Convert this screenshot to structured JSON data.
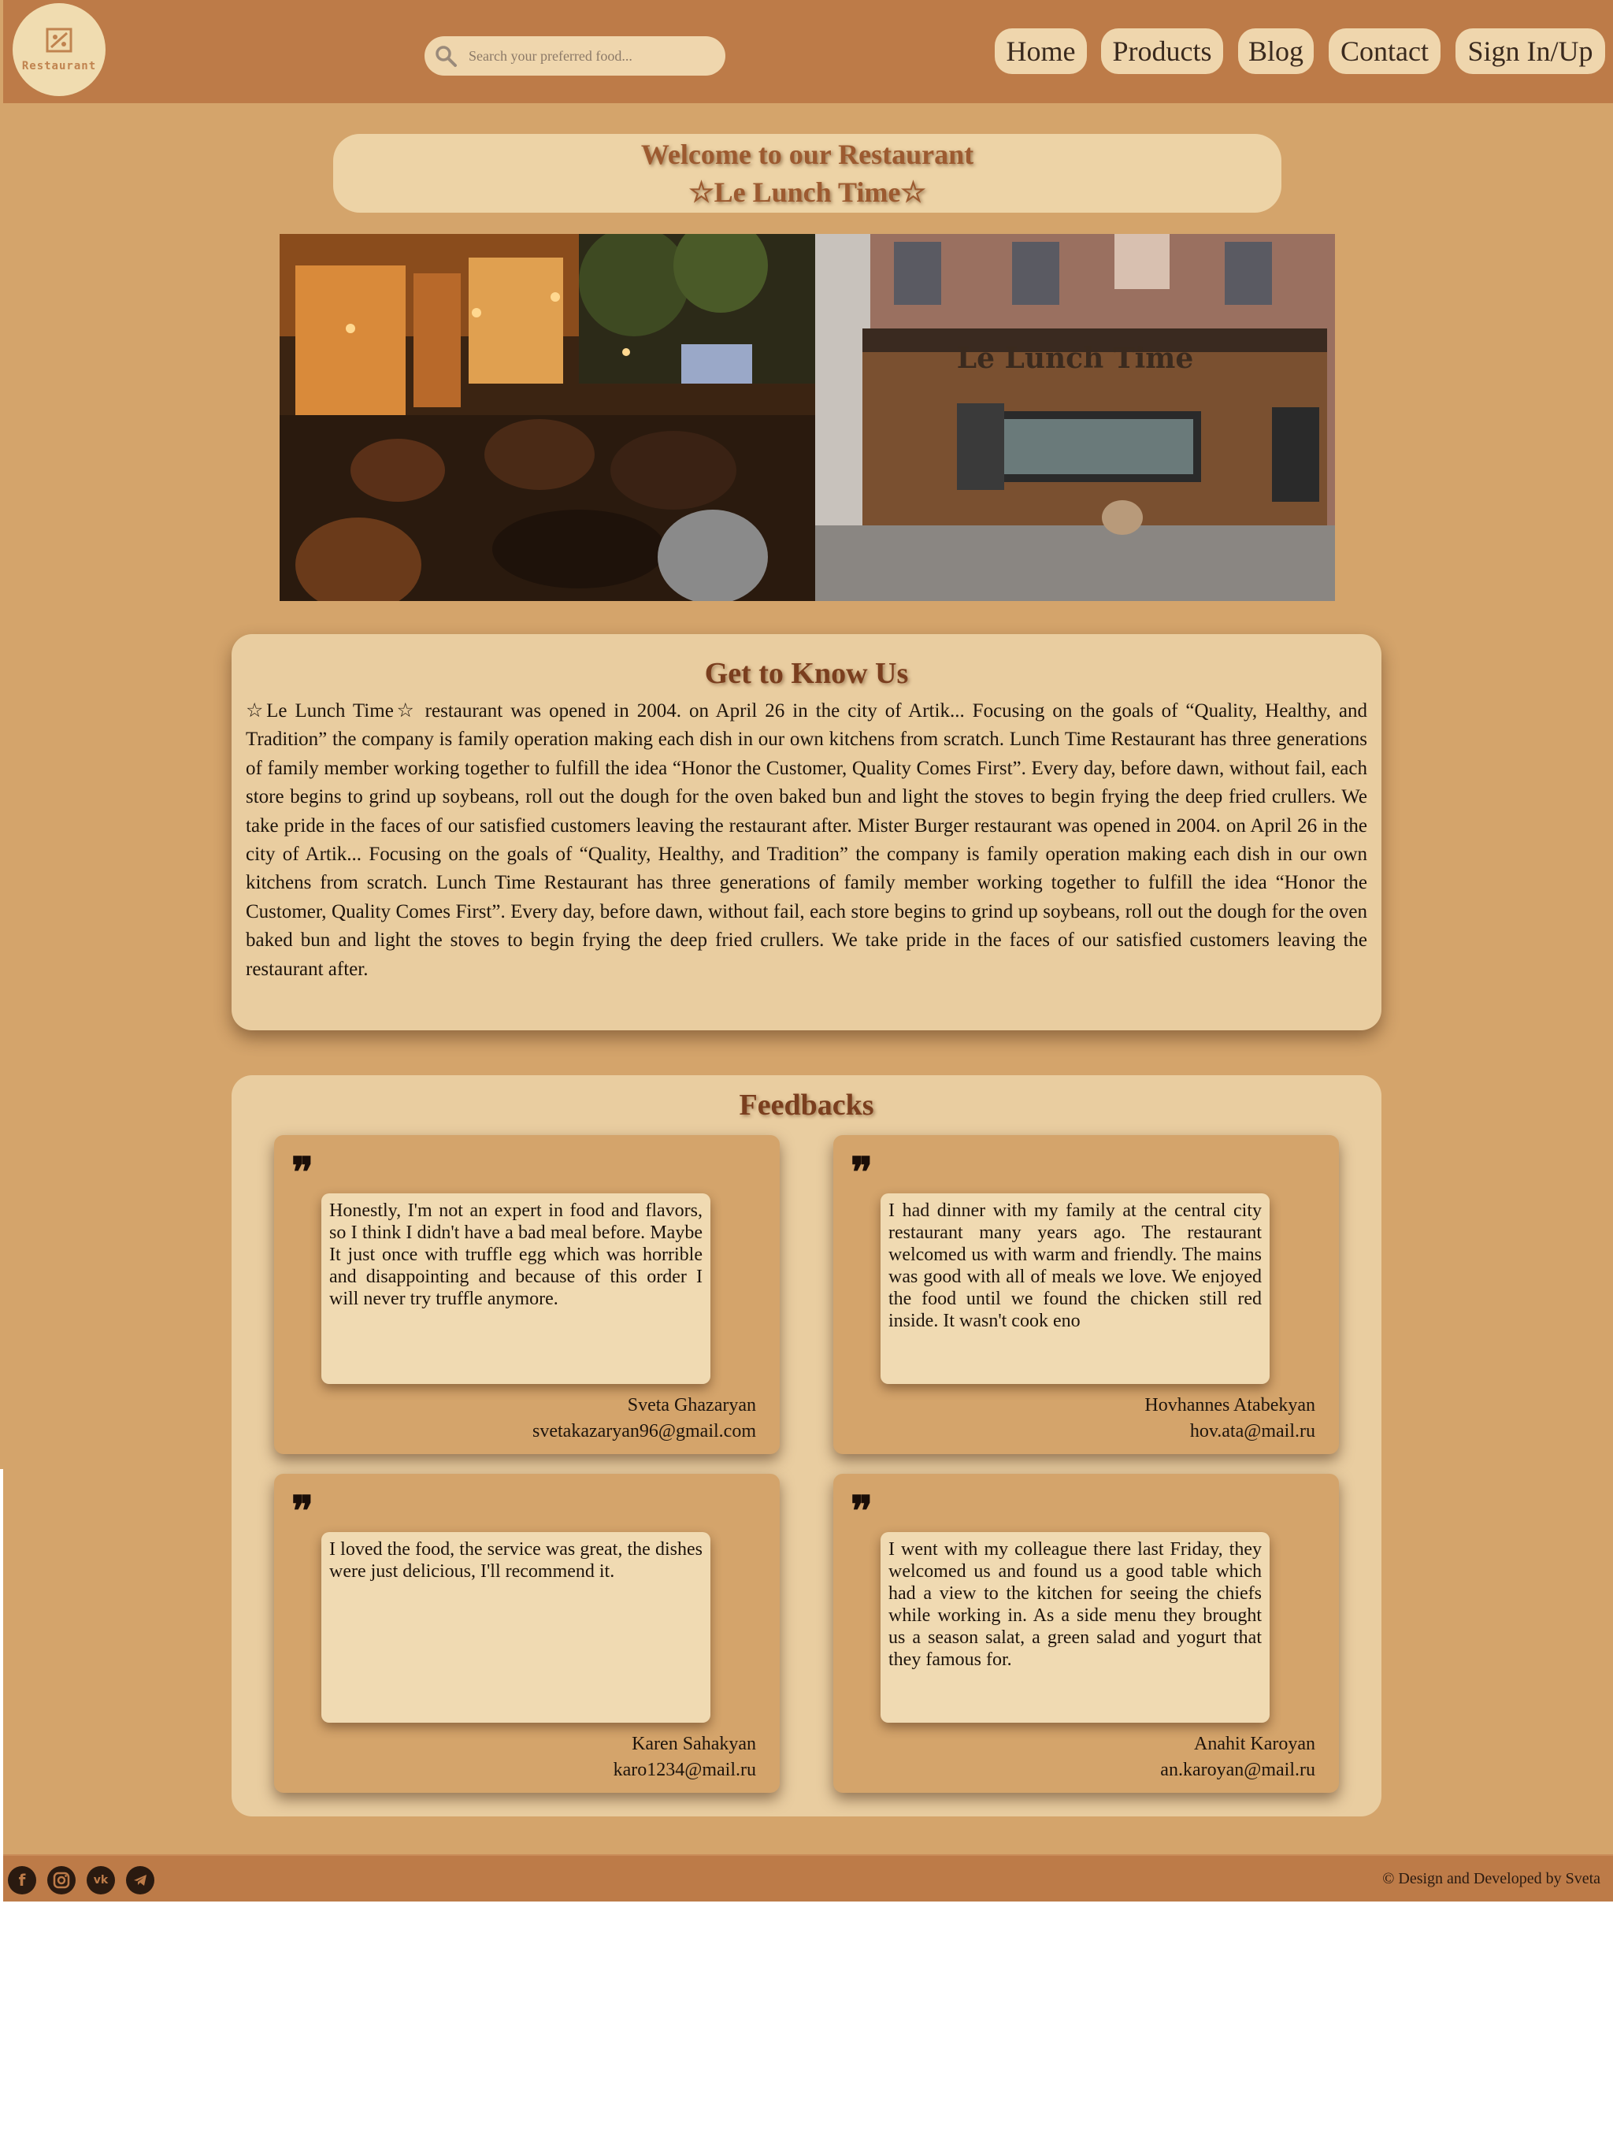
{
  "header": {
    "logo_text": "Restaurant",
    "search_placeholder": "Search your preferred food...",
    "nav": [
      "Home",
      "Products",
      "Blog",
      "Contact",
      "Sign In/Up"
    ]
  },
  "welcome": {
    "line1": "Welcome to our Restaurant",
    "line2": "☆Le Lunch Time☆"
  },
  "photos": {
    "right_sign_text": "Le Lunch Time"
  },
  "about": {
    "title": "Get to Know Us",
    "text": "☆Le Lunch Time☆ restaurant was opened in 2004. on April 26 in the city of Artik... Focusing on the goals of “Quality, Healthy, and Tradition” the company is family operation making each dish in our own kitchens from scratch. Lunch Time Restaurant has three generations of family member working together to fulfill the idea “Honor the Customer, Quality Comes First”. Every day, before dawn, without fail, each store begins to grind up soybeans, roll out the dough for the oven baked bun and light the stoves to begin frying the deep fried crullers. We take pride in the faces of our satisfied customers leaving the restaurant after. Mister Burger restaurant was opened in 2004. on April 26 in the city of Artik... Focusing on the goals of “Quality, Healthy, and Tradition” the company is family operation making each dish in our own kitchens from scratch. Lunch Time Restaurant has three generations of family member working together to fulfill the idea “Honor the Customer, Quality Comes First”. Every day, before dawn, without fail, each store begins to grind up soybeans, roll out the dough for the oven baked bun and light the stoves to begin frying the deep fried crullers. We take pride in the faces of our satisfied customers leaving the restaurant after."
  },
  "feedbacks": {
    "title": "Feedbacks",
    "quote_glyph": "❞",
    "items": [
      {
        "text": "Honestly, I'm not an expert in food and flavors, so I think I didn't have a bad meal before. Maybe It just once with truffle egg which was horrible and disappointing and because of this order I will never try truffle anymore.",
        "name": "Sveta Ghazaryan",
        "email": "svetakazaryan96@gmail.com"
      },
      {
        "text": "I had dinner with my family at the central city restaurant many years ago. The restaurant welcomed us with warm and friendly. The mains was good with all of meals we love. We enjoyed the food until we found the chicken still red inside. It wasn't cook eno",
        "name": "Hovhannes Atabekyan",
        "email": "hov.ata@mail.ru"
      },
      {
        "text": "I loved the food, the service was great, the dishes were just delicious, I'll recommend it.",
        "name": "Karen Sahakyan",
        "email": "karo1234@mail.ru"
      },
      {
        "text": "I went with my colleague there last Friday, they welcomed us and found us a good table which had a view to the kitchen for seeing the chiefs while working in. As a side menu they brought us a season salat, a green salad and yogurt that they famous for.",
        "name": "Anahit Karoyan",
        "email": "an.karoyan@mail.ru"
      }
    ]
  },
  "footer": {
    "social_icons": [
      "facebook-icon",
      "instagram-icon",
      "vk-icon",
      "telegram-icon"
    ],
    "copyright": "© Design and Developed by Sveta"
  },
  "colors": {
    "header_bg": "#bd7b48",
    "page_bg": "#d4a46b",
    "panel_bg": "#e9cda0",
    "title_brown": "#7a3e1e"
  }
}
